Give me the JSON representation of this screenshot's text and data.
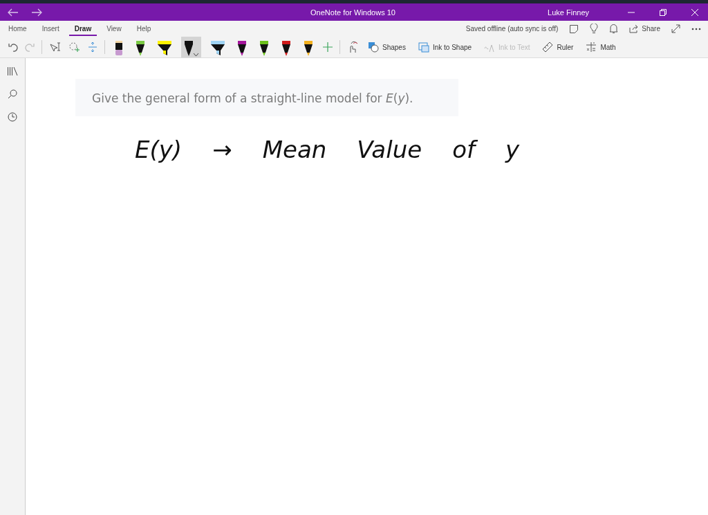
{
  "window": {
    "title": "OneNote for Windows 10",
    "user": "Luke Finney"
  },
  "tabs": [
    {
      "label": "Home",
      "selected": false
    },
    {
      "label": "Insert",
      "selected": false
    },
    {
      "label": "Draw",
      "selected": true
    },
    {
      "label": "View",
      "selected": false
    },
    {
      "label": "Help",
      "selected": false
    }
  ],
  "sync_status": "Saved offline (auto sync is off)",
  "share_label": "Share",
  "pens": [
    {
      "kind": "pencil",
      "color": "#c79ad0",
      "selected": false
    },
    {
      "kind": "pen",
      "color": "#7ac943",
      "selected": false
    },
    {
      "kind": "highlighter",
      "color": "#fff200",
      "selected": false
    },
    {
      "kind": "pen",
      "color": "#111111",
      "selected": true
    },
    {
      "kind": "highlighter",
      "color": "#9fd3f3",
      "selected": false
    },
    {
      "kind": "pen",
      "color": "#a3159a",
      "selected": false
    },
    {
      "kind": "pen",
      "color": "#6cc11b",
      "selected": false
    },
    {
      "kind": "pen",
      "color": "#d01c1c",
      "selected": false
    },
    {
      "kind": "pen",
      "color": "#f2b01e",
      "selected": false
    }
  ],
  "tools": [
    {
      "kind": "shapes",
      "label": "Shapes",
      "disabled": false
    },
    {
      "kind": "ink-to-shape",
      "label": "Ink to Shape",
      "disabled": false
    },
    {
      "kind": "ink-to-text",
      "label": "Ink to Text",
      "disabled": true
    },
    {
      "kind": "ruler",
      "label": "Ruler",
      "disabled": false
    },
    {
      "kind": "math",
      "label": "Math",
      "disabled": false
    }
  ],
  "question": "Give the general form of a straight-line model for *E*(*y*).",
  "handwriting": [
    "E(y)",
    "→",
    "Mean",
    "Value",
    "of",
    "y"
  ]
}
